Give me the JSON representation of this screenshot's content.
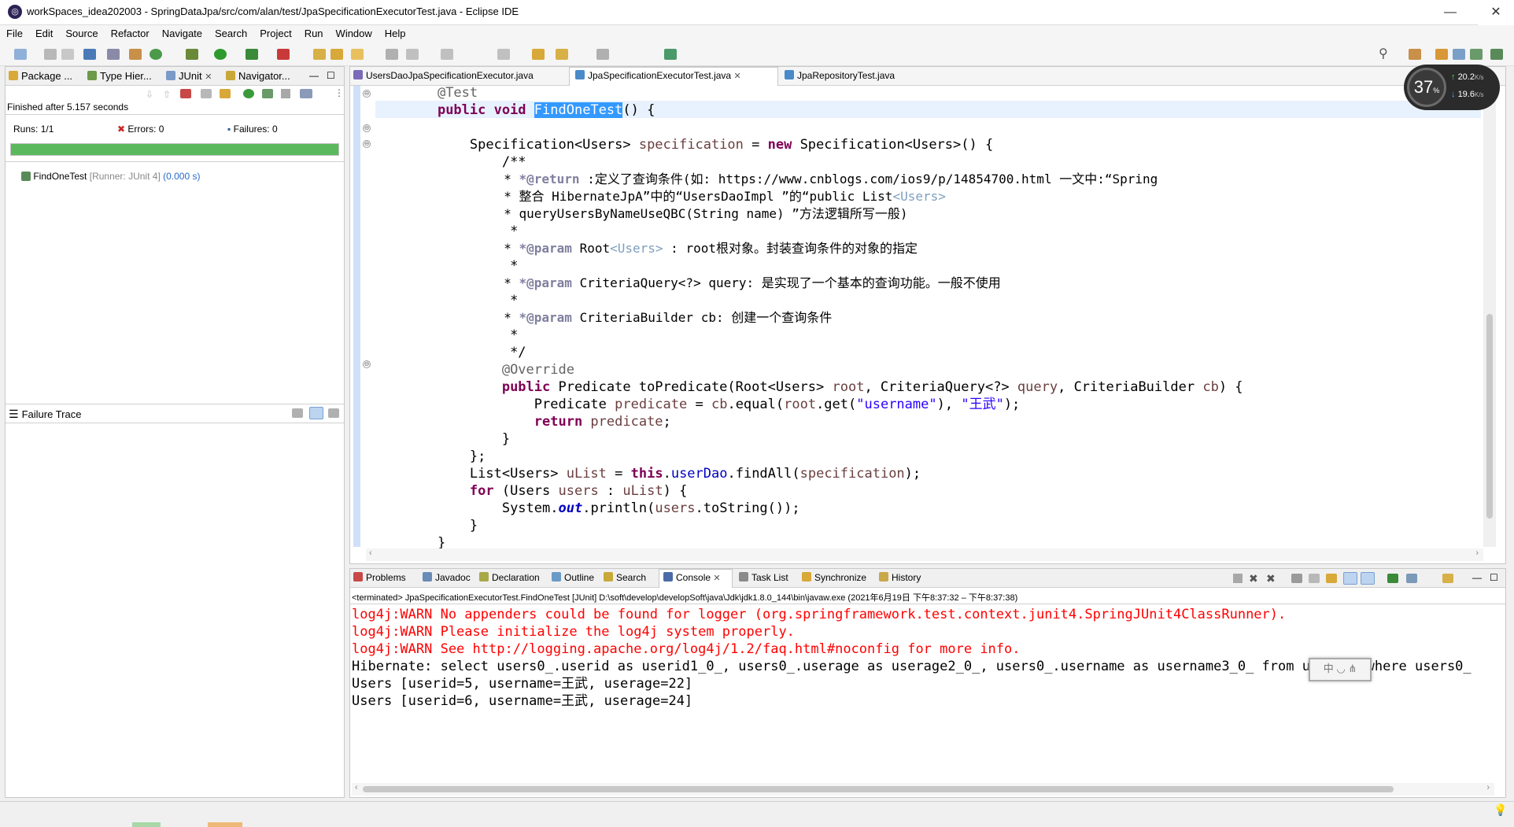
{
  "window": {
    "title": "workSpaces_idea202003 - SpringDataJpa/src/com/alan/test/JpaSpecificationExecutorTest.java - Eclipse IDE",
    "minimize": "—",
    "maximize": "☐",
    "close": "✕"
  },
  "menu": [
    "File",
    "Edit",
    "Source",
    "Refactor",
    "Navigate",
    "Search",
    "Project",
    "Run",
    "Window",
    "Help"
  ],
  "left_tabs": {
    "package": "Package ...",
    "type_hier": "Type Hier...",
    "junit": "JUnit",
    "navigator": "Navigator..."
  },
  "junit": {
    "finished": "Finished after 5.157 seconds",
    "runs_label": "Runs:",
    "runs_value": "1/1",
    "errors_label": "Errors:",
    "errors_value": "0",
    "failures_label": "Failures:",
    "failures_value": "0",
    "progress": 1.0,
    "progress_color": "#5cb85c",
    "test_name": "FindOneTest",
    "test_runner": "[Runner: JUnit 4]",
    "test_time": "(0.000 s)",
    "failure_trace_title": "Failure Trace"
  },
  "editor_tabs": [
    {
      "label": "UsersDaoJpaSpecificationExecutor.java",
      "active": false
    },
    {
      "label": "JpaSpecificationExecutorTest.java",
      "active": true
    },
    {
      "label": "JpaRepositoryTest.java",
      "active": false
    }
  ],
  "net_widget": {
    "cpu": "37",
    "cpu_unit": "%",
    "up": "20.2",
    "up_unit": "K/s",
    "down": "19.6",
    "down_unit": "K/s"
  },
  "code": {
    "l1_ann": "@Test",
    "l2_kw": "public void ",
    "l2_name": "FindOneTest",
    "l2_rest": "() {",
    "l4_a": "Specification<Users> ",
    "l4_var": "specification",
    "l4_b": " = ",
    "l4_kw": "new",
    "l4_c": " Specification<Users>() {",
    "c1": "/**",
    "c2_pre": " * ",
    "c2_tag": "*@return",
    "c2_text": " :定义了查询条件(如: https://www.cnblogs.com/ios9/p/14854700.html 一文中:“Spring",
    "c3_text": " * 整合 HibernateJpA”中的“UsersDaoImpl ”的“public List",
    "c3_tag": "<Users>",
    "c4_text": " * queryUsersByNameUseQBC(String name) ”方法逻辑所写一般)",
    "c5": " *",
    "c6_pre": " * ",
    "c6_tag": "*@param",
    "c6_text": " Root",
    "c6_tag2": "<Users>",
    "c6_text2": " : root根对象。封装查询条件的对象的指定",
    "c7": " *",
    "c8_pre": " * ",
    "c8_tag": "*@param",
    "c8_text": " CriteriaQuery<?> query: 是实现了一个基本的查询功能。一般不使用",
    "c9": " *",
    "c10_pre": " * ",
    "c10_tag": "*@param",
    "c10_text": " CriteriaBuilder cb: 创建一个查询条件",
    "c11": " *",
    "c12": " */",
    "ov": "@Override",
    "p1_kw": "public",
    "p1_a": " Predicate toPredicate(Root<Users> ",
    "p1_v1": "root",
    "p1_b": ", CriteriaQuery<?> ",
    "p1_v2": "query",
    "p1_c": ", CriteriaBuilder ",
    "p1_v3": "cb",
    "p1_d": ") {",
    "p2_a": "Predicate ",
    "p2_v1": "predicate",
    "p2_b": " = ",
    "p2_v2": "cb",
    "p2_c": ".equal(",
    "p2_v3": "root",
    "p2_d": ".get(",
    "p2_s1": "\"username\"",
    "p2_e": "), ",
    "p2_s2": "\"王武\"",
    "p2_f": ");",
    "p3_kw": "return",
    "p3_v": " predicate",
    "p3_e": ";",
    "p4": "}",
    "p5": "};",
    "u_a": "List<Users> ",
    "u_v": "uList",
    "u_b": " = ",
    "u_kw": "this",
    "u_c": ".",
    "u_f": "userDao",
    "u_d": ".findAll(",
    "u_v2": "specification",
    "u_e": ");",
    "f_kw": "for",
    "f_a": " (Users ",
    "f_v": "users",
    "f_b": " : ",
    "f_v2": "uList",
    "f_c": ") {",
    "s_a": "System.",
    "s_out": "out",
    "s_b": ".println(",
    "s_v": "users",
    "s_c": ".toString());",
    "close1": "}",
    "close2": "}"
  },
  "bottom_tabs": [
    "Problems",
    "Javadoc",
    "Declaration",
    "Outline",
    "Search",
    "Console",
    "Task List",
    "Synchronize",
    "History"
  ],
  "console": {
    "header": "<terminated> JpaSpecificationExecutorTest.FindOneTest [JUnit] D:\\soft\\develop\\developSoft\\java\\Jdk\\jdk1.8.0_144\\bin\\javaw.exe  (2021年6月19日 下午8:37:32 – 下午8:37:38)",
    "lines": [
      {
        "text": "log4j:WARN No appenders could be found for logger (org.springframework.test.context.junit4.SpringJUnit4ClassRunner).",
        "error": true
      },
      {
        "text": "log4j:WARN Please initialize the log4j system properly.",
        "error": true
      },
      {
        "text": "log4j:WARN See http://logging.apache.org/log4j/1.2/faq.html#noconfig for more info.",
        "error": true
      },
      {
        "text": "Hibernate: select users0_.userid as userid1_0_, users0_.userage as userage2_0_, users0_.username as username3_0_ from users0_ where users0_",
        "error": false
      },
      {
        "text": "Users [userid=5, username=王武, userage=22]",
        "error": false
      },
      {
        "text": "Users [userid=6, username=王武, userage=24]",
        "error": false
      }
    ],
    "ime_text": "中 ◡ ⋔"
  }
}
